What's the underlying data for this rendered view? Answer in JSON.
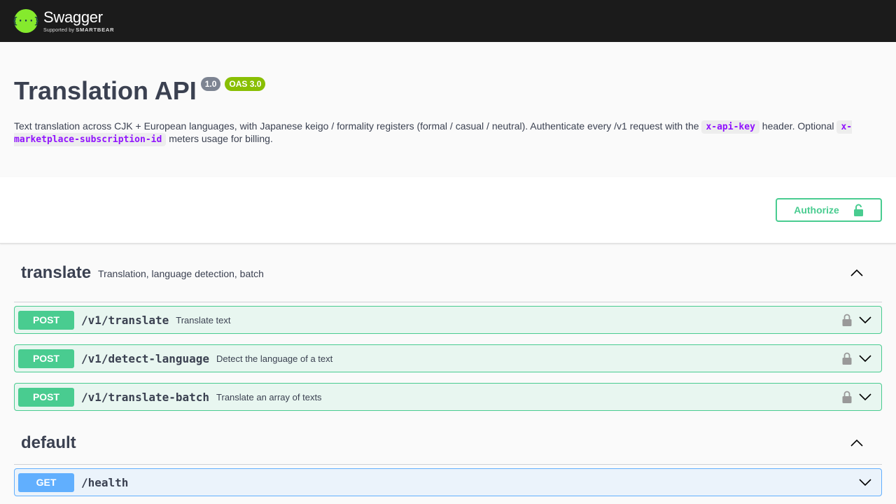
{
  "topbar": {
    "logo_mark": "{···}",
    "logo_name": "Swagger",
    "logo_sub_prefix": "Supported by ",
    "logo_sub_brand": "SMARTBEAR"
  },
  "info": {
    "title": "Translation API",
    "version": "1.0",
    "oas": "OAS 3.0",
    "description_1": "Text translation across CJK + European languages, with Japanese keigo / formality registers (formal / casual / neutral). Authenticate every /v1 request with the ",
    "code_1": "x-api-key",
    "description_2": " header. Optional ",
    "code_2": "x-marketplace-subscription-id",
    "description_3": " meters usage for billing."
  },
  "authorize": {
    "label": "Authorize",
    "icon": "unlock-icon"
  },
  "tags": [
    {
      "name": "translate",
      "description": "Translation, language detection, batch",
      "operations": [
        {
          "method": "POST",
          "path": "/v1/translate",
          "summary": "Translate text"
        },
        {
          "method": "POST",
          "path": "/v1/detect-language",
          "summary": "Detect the language of a text"
        },
        {
          "method": "POST",
          "path": "/v1/translate-batch",
          "summary": "Translate an array of texts"
        }
      ]
    },
    {
      "name": "default",
      "description": "",
      "operations": [
        {
          "method": "GET",
          "path": "/health",
          "summary": ""
        }
      ]
    }
  ],
  "colors": {
    "post": "#49cc90",
    "get": "#61affe",
    "topbar": "#1b1b1b",
    "logo": "#85ea2d",
    "code": "#9012fe"
  }
}
